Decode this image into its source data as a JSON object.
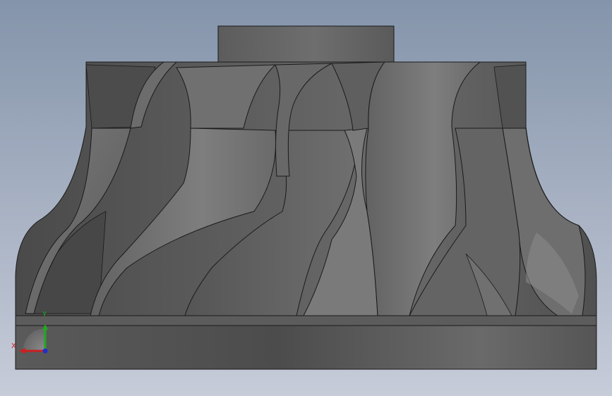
{
  "viewport": {
    "colors": {
      "bg_top": "#8494aa",
      "bg_bottom": "#c7ccd9",
      "part_dark": "#4a4a4a",
      "part_mid": "#6a6a6a",
      "part_light": "#8a8a8a",
      "edge": "#1a1a1a"
    }
  },
  "triad": {
    "x_label": "X",
    "y_label": "Y",
    "x_color": "#cc1f1f",
    "y_color": "#1faa1f",
    "z_color": "#1f2fcc"
  }
}
